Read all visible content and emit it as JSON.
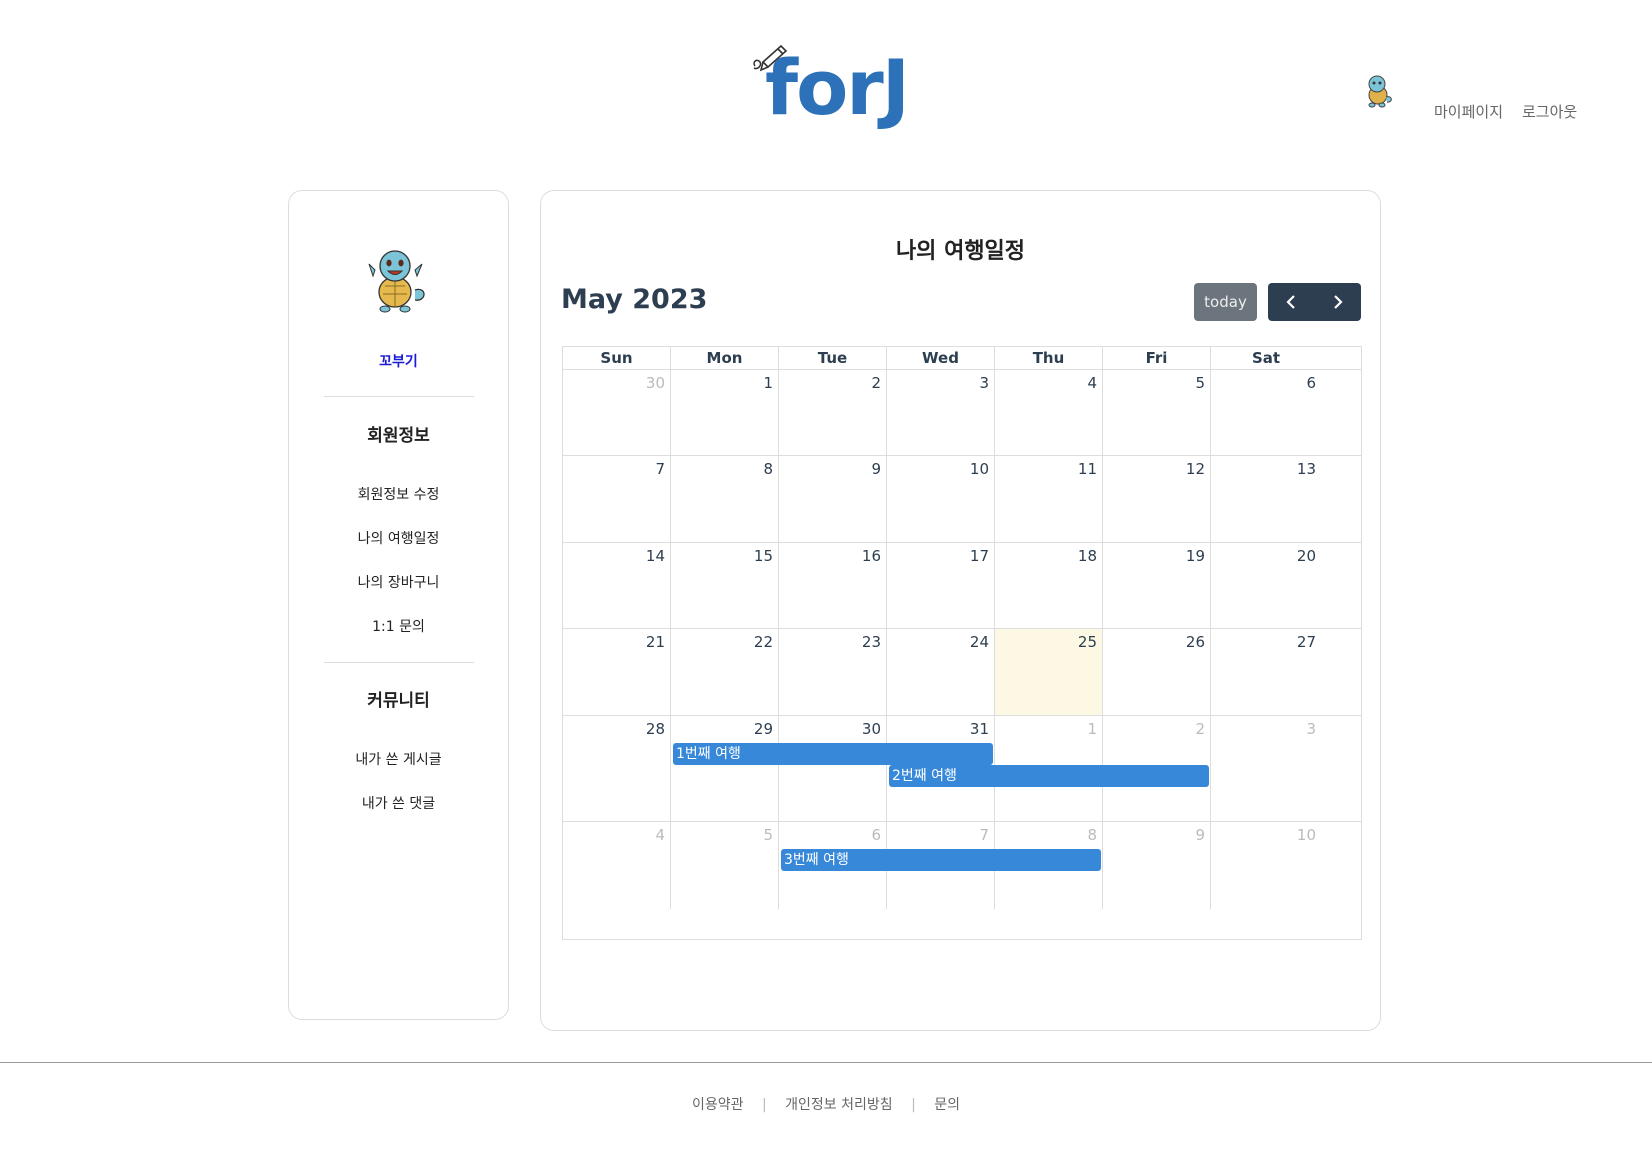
{
  "header": {
    "logo_text": "forJ",
    "links": {
      "mypage": "마이페이지",
      "logout": "로그아웃"
    }
  },
  "sidebar": {
    "username": "꼬부기",
    "sections": [
      {
        "heading": "회원정보",
        "items": [
          "회원정보 수정",
          "나의 여행일정",
          "나의 장바구니",
          "1:1 문의"
        ]
      },
      {
        "heading": "커뮤니티",
        "items": [
          "내가 쓴 게시글",
          "내가 쓴 댓글"
        ]
      }
    ]
  },
  "main": {
    "page_title": "나의 여행일정",
    "calendar_title": "May 2023",
    "today_label": "today",
    "prev_icon": "chevron-left-icon",
    "next_icon": "chevron-right-icon",
    "weekdays": [
      "Sun",
      "Mon",
      "Tue",
      "Wed",
      "Thu",
      "Fri",
      "Sat"
    ],
    "weeks": [
      [
        "30",
        "1",
        "2",
        "3",
        "4",
        "5",
        "6"
      ],
      [
        "7",
        "8",
        "9",
        "10",
        "11",
        "12",
        "13"
      ],
      [
        "14",
        "15",
        "16",
        "17",
        "18",
        "19",
        "20"
      ],
      [
        "21",
        "22",
        "23",
        "24",
        "25",
        "26",
        "27"
      ],
      [
        "28",
        "29",
        "30",
        "31",
        "1",
        "2",
        "3"
      ],
      [
        "4",
        "5",
        "6",
        "7",
        "8",
        "9",
        "10"
      ]
    ],
    "events": [
      {
        "title": "1번째 여행"
      },
      {
        "title": "2번째 여행"
      },
      {
        "title": "3번째 여행"
      }
    ],
    "colors": {
      "event": "#3788d8",
      "today": "#fcf8e3",
      "toolbar": "#2c3e50"
    }
  },
  "footer": {
    "links": [
      "이용약관",
      "개인정보 처리방침",
      "문의"
    ],
    "separator": "|"
  }
}
